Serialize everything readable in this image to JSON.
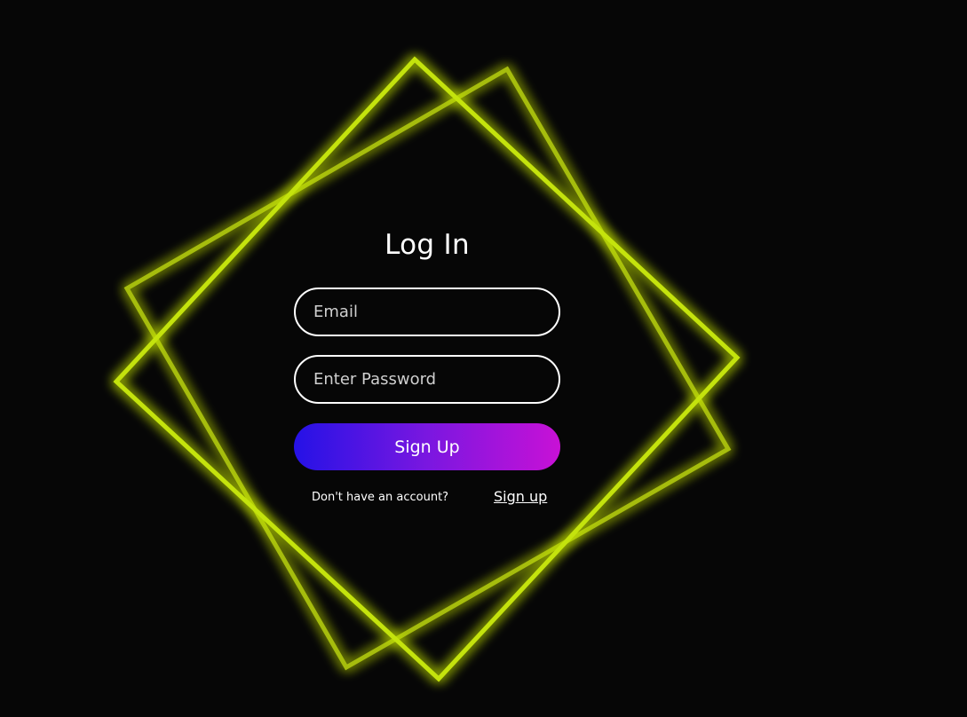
{
  "form": {
    "title": "Log In",
    "email_placeholder": "Email",
    "password_placeholder": "Enter Password",
    "submit_label": "Sign Up",
    "signup_prompt": "Don't have an account?",
    "signup_link": "Sign up"
  },
  "colors": {
    "background": "#060606",
    "neon_primary": "#c4e30a",
    "neon_secondary": "#a6bd0c",
    "button_gradient_start": "#2512e6",
    "button_gradient_end": "#c811d6",
    "text": "#ffffff"
  }
}
